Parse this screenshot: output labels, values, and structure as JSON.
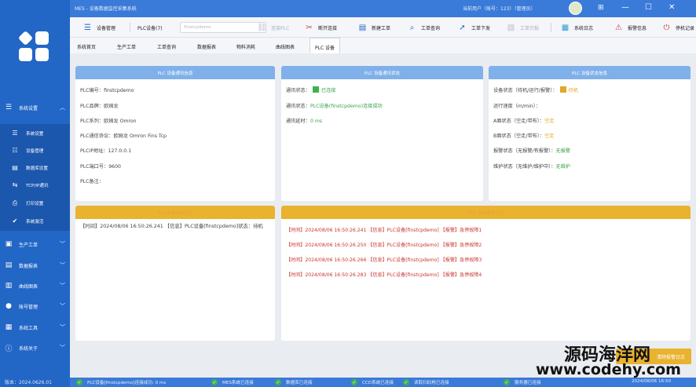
{
  "app": {
    "title": "MES - 设备数据监控采集系统",
    "user_info": "当前用户（账号：123）（管理员）"
  },
  "window_buttons": {
    "minimize": "—",
    "maximize": "☐",
    "close": "✕"
  },
  "colors": {
    "sidebar": "#2266c6",
    "topbar": "#3a7ad8",
    "panel_header_blue": "#7fb0ea",
    "panel_header_gold": "#e9b22f",
    "status_ok": "#3fb24f",
    "alarm": "#c8362e",
    "indicator_yellow": "#e0a72a"
  },
  "sidebar": {
    "groups": [
      {
        "label": "系统设置",
        "icon": "menu-icon"
      },
      {
        "label": "生产工单",
        "icon": "clipboard-icon"
      },
      {
        "label": "数据报表",
        "icon": "database-icon"
      },
      {
        "label": "曲线图表",
        "icon": "bar-chart-icon"
      },
      {
        "label": "账号管理",
        "icon": "user-icon"
      },
      {
        "label": "系统工具",
        "icon": "toolbox-icon"
      },
      {
        "label": "系统关于",
        "icon": "info-icon"
      }
    ],
    "items": [
      {
        "label": "系统设置",
        "icon": "list-icon"
      },
      {
        "label": "设备管理",
        "icon": "device-list-icon"
      },
      {
        "label": "数据库设置",
        "icon": "database-icon"
      },
      {
        "label": "TCP/IP通讯",
        "icon": "network-icon"
      },
      {
        "label": "打印设置",
        "icon": "printer-icon"
      },
      {
        "label": "系统激活",
        "icon": "shield-check-icon"
      }
    ],
    "version": "版本：2024.0626.01"
  },
  "toolbar": {
    "device_manage": "设备管理",
    "plc_device": "PLC设备(7)",
    "plc_input": "finstcpdemo",
    "connect_plc": "连接PLC",
    "disconnect": "断开连接",
    "new_order": "新建工单",
    "order_query": "工单查询",
    "order_issue": "工单下发",
    "order_report": "工单完报",
    "system_log": "系统日志",
    "alarm_info": "报警信息",
    "stop_record": "停机记录"
  },
  "tabs": [
    "系统首页",
    "生产工单",
    "工单查询",
    "数据报表",
    "物料消耗",
    "曲线图表",
    "PLC 设备"
  ],
  "panels": {
    "plc_info": {
      "title": "PLC 设备通讯信息",
      "rows": [
        {
          "label": "PLC编号：",
          "value": "finstcpdemo"
        },
        {
          "label": "PLC品牌：",
          "value": "欧姆龙"
        },
        {
          "label": "PLC系列：",
          "value": "欧姆龙 Omron"
        },
        {
          "label": "PLC通信协议：",
          "value": "欧姆龙 Omron Fins Tcp"
        },
        {
          "label": "PLCIP地址：",
          "value": "127.0.0.1"
        },
        {
          "label": "PLC端口号：",
          "value": "9600"
        },
        {
          "label": "PLC备注：",
          "value": ""
        }
      ]
    },
    "comm_status": {
      "title": "PLC 设备通讯状态",
      "connect_label": "通讯状态：",
      "connect_value": "已连接",
      "state_label": "通讯状态：",
      "state_value": "PLC设备(finstcpdemo)连接成功",
      "latency_label": "通讯延时：",
      "latency_value": "0 ms"
    },
    "dev_status": {
      "title": "PLC 设备状态信息",
      "rows": [
        {
          "label": "设备状态（待机/运行/报警）：",
          "value": "待机"
        },
        {
          "label": "运行速度（m/min）：",
          "value": ""
        },
        {
          "label": "A面状态（空走/带布）：",
          "value": "空走"
        },
        {
          "label": "B面状态（空走/带布）：",
          "value": "空走"
        },
        {
          "label": "报警状态（无报警/有报警）：",
          "value": "无报警"
        },
        {
          "label": "维护状态（无维护/维护中）：",
          "value": "无维护"
        }
      ]
    },
    "status_log": {
      "title": "PLC 设备状态日志",
      "text": "【时间】2024/08/06 16:50:26.241 【信息】PLC设备[finstcpdemo]状态：待机"
    },
    "alarm_log": {
      "title": "PLC 设备报警日志",
      "entries": [
        "【时间】2024/08/06 16:50:26.241 【信息】PLC设备[finstcpdemo] 【报警】急停故障1",
        "【时间】2024/08/06 16:50:26.250 【信息】PLC设备[finstcpdemo] 【报警】急停故障2",
        "【时间】2024/08/06 16:50:26.266 【信息】PLC设备[finstcpdemo] 【报警】急停故障3",
        "【时间】2024/08/06 16:50:26.283 【信息】PLC设备[finstcpdemo] 【报警】急停故障4"
      ]
    }
  },
  "corner_button": "清除报警日志",
  "statusbar": [
    "PLC设备[finstcpdemo]连接成功: 0 ms",
    "MES系统已连接",
    "数据库已连接",
    "CCD系统已连接",
    "读取扫码枪已连接",
    "服务器已连接",
    "2024/08/06 16:50"
  ],
  "watermark": {
    "line1": "源码海洋网",
    "line2": "www.codehy.com"
  }
}
